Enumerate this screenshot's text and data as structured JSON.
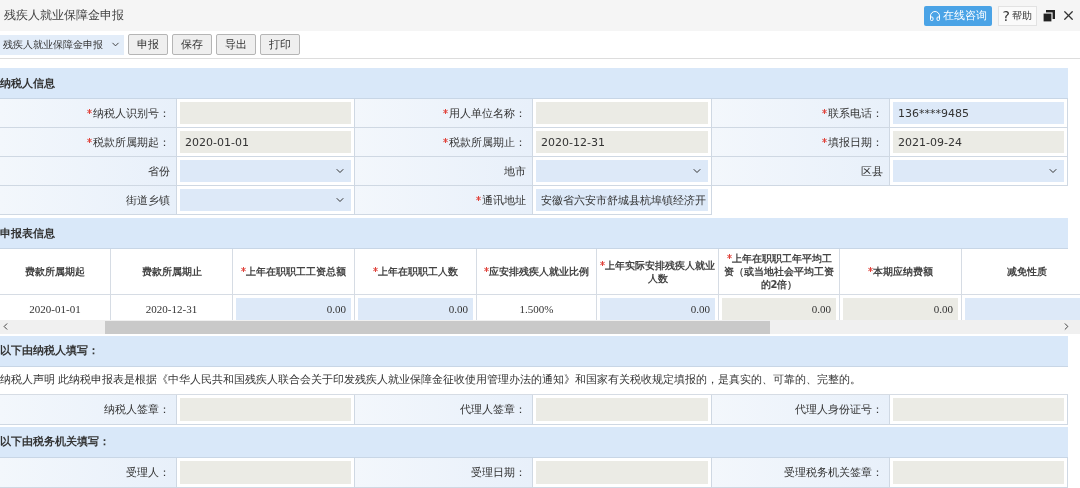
{
  "window": {
    "title": "残疾人就业保障金申报",
    "consult": "在线咨询",
    "help_symbol": "?",
    "help": "帮助"
  },
  "toolbar": {
    "form_select": "残疾人就业保障金申报",
    "buttons": [
      "申报",
      "保存",
      "导出",
      "打印"
    ]
  },
  "taxpayer": {
    "title": "纳税人信息",
    "rows": [
      [
        {
          "label": "纳税人识别号：",
          "required": true,
          "kind": "readonly"
        },
        {
          "label": "用人单位名称：",
          "required": true,
          "kind": "readonly"
        },
        {
          "label": "联系电话：",
          "required": true,
          "kind": "input",
          "value": "136****9485"
        }
      ],
      [
        {
          "label": "税款所属期起：",
          "required": true,
          "kind": "readonly",
          "value": "2020-01-01"
        },
        {
          "label": "税款所属期止：",
          "required": true,
          "kind": "readonly",
          "value": "2020-12-31"
        },
        {
          "label": "填报日期：",
          "required": true,
          "kind": "readonly",
          "value": "2021-09-24"
        }
      ],
      [
        {
          "label": "省份",
          "required": false,
          "kind": "select"
        },
        {
          "label": "地市",
          "required": false,
          "kind": "select"
        },
        {
          "label": "区县",
          "required": false,
          "kind": "select"
        }
      ],
      [
        {
          "label": "街道乡镇",
          "required": false,
          "kind": "select"
        },
        {
          "label": "通讯地址",
          "required": true,
          "kind": "input",
          "value": "安徽省六安市舒城县杭埠镇经济开"
        }
      ]
    ]
  },
  "report": {
    "title": "申报表信息",
    "columns": [
      {
        "label": "费款所属期起",
        "required": false
      },
      {
        "label": "费款所属期止",
        "required": false
      },
      {
        "label": "上年在职职工工资总额",
        "required": true
      },
      {
        "label": "上年在职职工人数",
        "required": true
      },
      {
        "label": "应安排残疾人就业比例",
        "required": true
      },
      {
        "label": "上年实际安排残疾人就业人数",
        "required": true
      },
      {
        "label": "上年在职职工年平均工资（或当地社会平均工资的2倍）",
        "required": true
      },
      {
        "label": "本期应纳费额",
        "required": true
      },
      {
        "label": "减免性质",
        "required": false
      }
    ],
    "rows": [
      [
        {
          "kind": "text",
          "value": "2020-01-01"
        },
        {
          "kind": "text",
          "value": "2020-12-31"
        },
        {
          "kind": "input",
          "value": "0.00"
        },
        {
          "kind": "input",
          "value": "0.00"
        },
        {
          "kind": "text",
          "value": "1.500%"
        },
        {
          "kind": "input",
          "value": "0.00"
        },
        {
          "kind": "readonly",
          "value": "0.00"
        },
        {
          "kind": "readonly",
          "value": "0.00"
        },
        {
          "kind": "select"
        }
      ]
    ]
  },
  "taxpayer_fill": {
    "title": "以下由纳税人填写：",
    "declaration": "纳税人声明 此纳税申报表是根据《中华人民共和国残疾人联合会关于印发残疾人就业保障金征收使用管理办法的通知》和国家有关税收规定填报的，是真实的、可靠的、完整的。",
    "fields": [
      {
        "label": "纳税人签章：",
        "required": false,
        "kind": "readonly"
      },
      {
        "label": "代理人签章：",
        "required": false,
        "kind": "readonly"
      },
      {
        "label": "代理人身份证号：",
        "required": false,
        "kind": "readonly"
      }
    ]
  },
  "tax_office_fill": {
    "title": "以下由税务机关填写：",
    "fields": [
      {
        "label": "受理人：",
        "required": false,
        "kind": "readonly"
      },
      {
        "label": "受理日期：",
        "required": false,
        "kind": "readonly"
      },
      {
        "label": "受理税务机关签章：",
        "required": false,
        "kind": "readonly"
      }
    ]
  }
}
